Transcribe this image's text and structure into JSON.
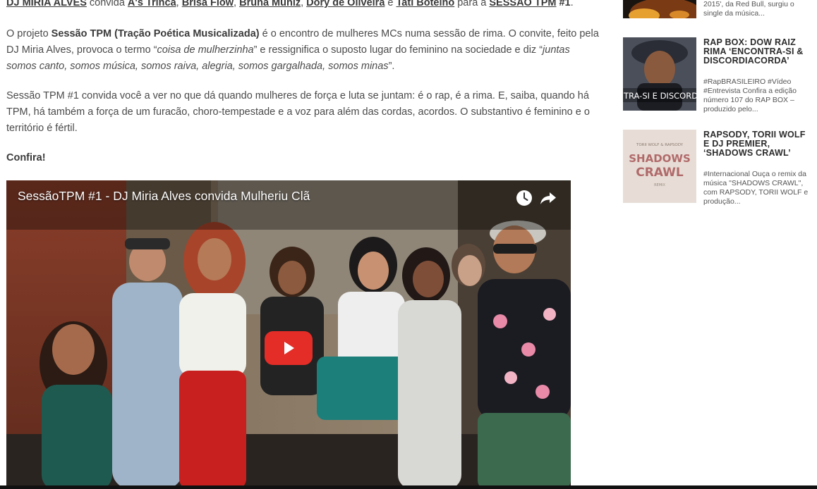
{
  "article": {
    "intro": {
      "dj": "DJ MIRIA ALVES",
      "convida": " convida ",
      "g1": "A's Trinca",
      "sep1": ", ",
      "g2": "Brisa Flow",
      "sep2": ", ",
      "g3": "Bruna Muniz",
      "sep3": ", ",
      "g4": "Dory de Oliveira",
      "e": " e ",
      "g5": "Tati Botelho",
      "para": " para a ",
      "sessao": "SESSÃO TPM",
      "num": " #1",
      "end": "."
    },
    "p2": {
      "t1": "O projeto ",
      "b1": "Sessão TPM (Tração Poética Musicalizada)",
      "t2": " é o encontro de mulheres MCs numa sessão de rima. O convite, feito pela DJ Miria Alves, provoca o termo “",
      "i1": "coisa de mulherzinha",
      "t3": "” e ressignifica o suposto lugar do feminino na sociedade e diz “",
      "i2": "juntas somos canto, somos música, somos raiva, alegria, somos gargalhada, somos minas",
      "t4": "”."
    },
    "p3": "Sessão TPM #1 convida você a ver no que dá quando mulheres de força e luta se juntam: é o rap, é a rima. E, saiba, quando há TPM, há também a força de um furacão, choro-tempestade e a voz para além das cordas, acordos. O substantivo é feminino e o território é fértil.",
    "p4": "Confira!"
  },
  "video": {
    "title": "SessãoTPM #1 - DJ Miria Alves convida Mulheriu Clã",
    "watch_later_icon": "clock-icon",
    "share_icon": "share-arrow-icon",
    "play_icon": "play-icon"
  },
  "sidebar": {
    "items": [
      {
        "title": "",
        "excerpt": "2015', da Red Bull, surgiu o single da música..."
      },
      {
        "title": "RAP BOX: DOW RAIZ RIMA ‘ENCONTRA-SI & DISCORDIACORDA’",
        "excerpt": "#RapBRASILEIRO #Vídeo #Entrevista Confira a edição número 107 do RAP BOX – produzido pelo...",
        "thumb_text": "TRA-SI E DISCORDIAC"
      },
      {
        "title": "RAPSODY, TORII WOLF E DJ PREMIER, ‘SHADOWS CRAWL’",
        "excerpt": "#Internacional Ouça o remix da música \"SHADOWS CRAWL\", com RAPSODY, TORII WOLF e produção...",
        "thumb_small": "TORII WOLF & RAPSODY",
        "thumb_big1": "SHADOWS",
        "thumb_big2": "CRAWL",
        "thumb_sub": "REMIX"
      }
    ]
  }
}
